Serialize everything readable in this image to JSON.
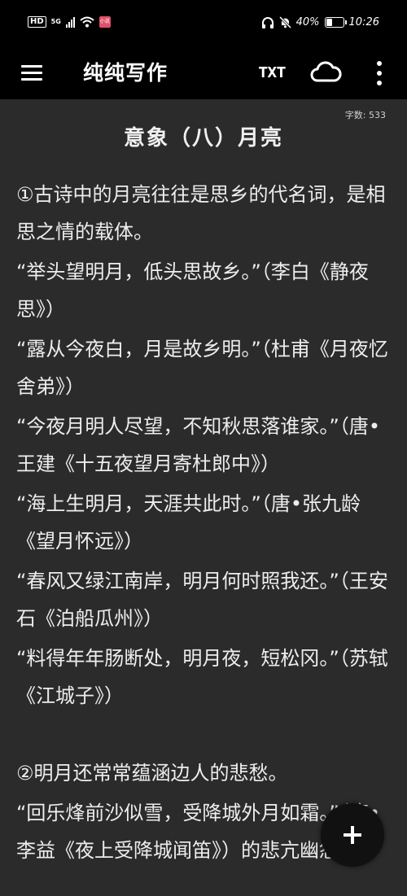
{
  "status_bar": {
    "left_badges": [
      "HD",
      "5G"
    ],
    "app_badge": "小说",
    "battery_percent": "40%",
    "battery_level": 0.4,
    "time": "10:26"
  },
  "app_bar": {
    "title": "纯纯写作",
    "txt_label": "TXT",
    "icons": [
      "menu-icon",
      "cloud-icon",
      "more-vertical-icon"
    ]
  },
  "document": {
    "word_count": "字数: 533",
    "title": "意象（八）月亮",
    "paragraphs": [
      "①古诗中的月亮往往是思乡的代名词，是相思之情的载体。",
      "“举头望明月，低头思故乡。”（李白《静夜思》）",
      "“露从今夜白，月是故乡明。”（杜甫《月夜忆舍弟》）",
      "“今夜月明人尽望，不知秋思落谁家。”（唐•王建《十五夜望月寄杜郎中》）",
      "“海上生明月，天涯共此时。”（唐•张九龄《望月怀远》）",
      "“春风又绿江南岸，明月何时照我还。”（王安石《泊船瓜州》）",
      "“料得年年肠断处，明月夜，短松冈。”（苏轼《江城子》）",
      "",
      "②明月还常常蕴涵边人的悲愁。",
      "“回乐烽前沙似雪，受降城外月如霜。”（唐•李益《夜上受降城闻笛》）的悲亢幽怨。"
    ]
  },
  "fab": {
    "icon": "plus-icon"
  },
  "colors": {
    "background": "#2b2b2b",
    "bars": "#000000",
    "text": "#ededed"
  }
}
